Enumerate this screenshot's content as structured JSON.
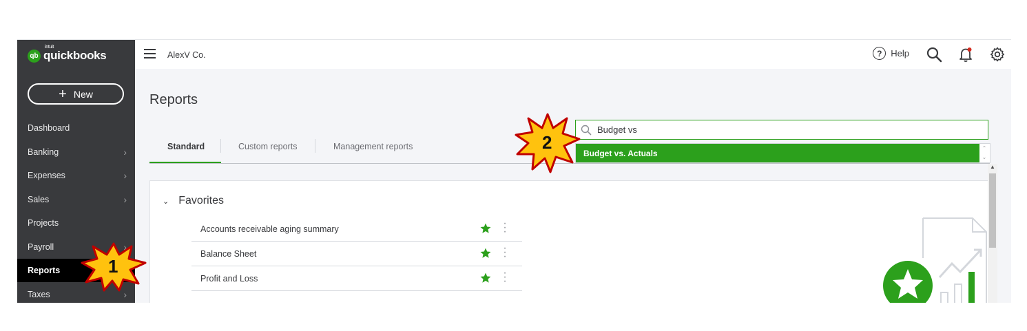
{
  "brand": {
    "intuit": "intuit",
    "name": "quickbooks",
    "badge": "qb"
  },
  "sidebar": {
    "new_label": "New",
    "items": [
      {
        "label": "Dashboard",
        "chevron": false
      },
      {
        "label": "Banking",
        "chevron": true
      },
      {
        "label": "Expenses",
        "chevron": true
      },
      {
        "label": "Sales",
        "chevron": true
      },
      {
        "label": "Projects",
        "chevron": false
      },
      {
        "label": "Payroll",
        "chevron": true
      },
      {
        "label": "Reports",
        "chevron": false,
        "active": true
      },
      {
        "label": "Taxes",
        "chevron": true
      }
    ]
  },
  "topbar": {
    "company": "AlexV Co.",
    "help_label": "Help"
  },
  "page": {
    "title": "Reports"
  },
  "tabs": [
    {
      "label": "Standard",
      "active": true
    },
    {
      "label": "Custom reports"
    },
    {
      "label": "Management reports"
    }
  ],
  "search": {
    "value": "Budget vs",
    "result": "Budget vs. Actuals"
  },
  "favorites": {
    "header": "Favorites",
    "items": [
      {
        "name": "Accounts receivable aging summary"
      },
      {
        "name": "Balance Sheet"
      },
      {
        "name": "Profit and Loss"
      }
    ]
  },
  "callouts": {
    "step1": "1",
    "step2": "2"
  },
  "colors": {
    "accent": "#2ca01c",
    "sidebar": "#393a3d",
    "callout": "#ffc20e",
    "callout_border": "#c00000"
  }
}
